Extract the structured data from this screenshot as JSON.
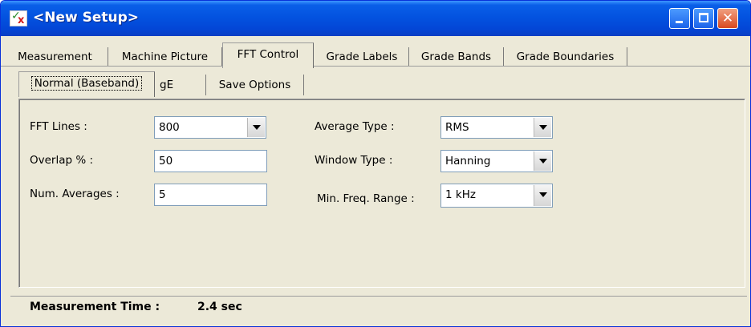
{
  "window": {
    "title": "<New Setup>",
    "icon": "setup-app-icon",
    "controls": [
      "minimize-icon",
      "maximize-icon",
      "close-icon"
    ]
  },
  "tabs_primary": [
    {
      "label": "Measurement"
    },
    {
      "label": "Machine Picture"
    },
    {
      "label": "FFT Control",
      "active": true
    },
    {
      "label": "Grade Labels"
    },
    {
      "label": "Grade Bands"
    },
    {
      "label": "Grade Boundaries"
    }
  ],
  "tabs_secondary": [
    {
      "label": "Normal (Baseband)",
      "active": true
    },
    {
      "label": "gE"
    },
    {
      "label": "Save Options"
    }
  ],
  "form": {
    "fft_lines": {
      "label": "FFT Lines :",
      "value": "800"
    },
    "overlap": {
      "label": "Overlap % :",
      "value": "50"
    },
    "num_averages": {
      "label": "Num. Averages :",
      "value": "5"
    },
    "average_type": {
      "label": "Average Type :",
      "value": "RMS"
    },
    "window_type": {
      "label": "Window Type :",
      "value": "Hanning"
    },
    "min_freq_range": {
      "label": "Min. Freq. Range :",
      "value": "1 kHz"
    }
  },
  "status": {
    "label": "Measurement Time :",
    "value": "2.4 sec"
  },
  "colors": {
    "titlebar": "#0353e0",
    "window_bg": "#ece9d8",
    "field_border": "#7f9db9"
  }
}
